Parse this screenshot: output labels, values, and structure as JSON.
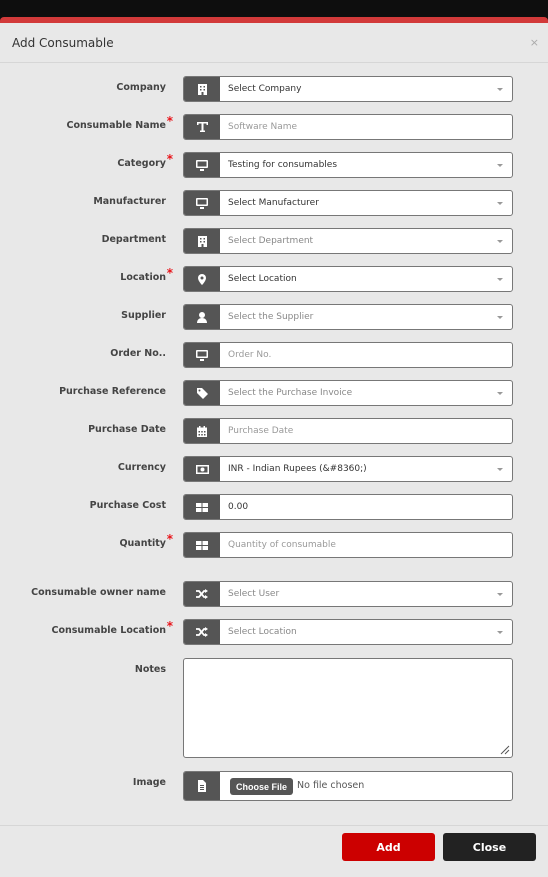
{
  "modal": {
    "title": "Add Consumable",
    "close_symbol": "×"
  },
  "fields": [
    {
      "label": "Company",
      "required": false,
      "icon": "building-icon",
      "type": "select",
      "value": "Select Company",
      "is_placeholder": false
    },
    {
      "label": "Consumable Name",
      "required": true,
      "icon": "text-icon",
      "type": "text",
      "value": "",
      "placeholder": "Software Name"
    },
    {
      "label": "Category",
      "required": true,
      "icon": "monitor-icon",
      "type": "select",
      "value": "Testing for consumables",
      "is_placeholder": false
    },
    {
      "label": "Manufacturer",
      "required": false,
      "icon": "monitor-icon",
      "type": "select",
      "value": "Select Manufacturer",
      "is_placeholder": false
    },
    {
      "label": "Department",
      "required": false,
      "icon": "building-icon",
      "type": "select",
      "value": "Select Department",
      "is_placeholder": true
    },
    {
      "label": "Location",
      "required": true,
      "icon": "map-marker-icon",
      "type": "select",
      "value": "Select Location",
      "is_placeholder": false
    },
    {
      "label": "Supplier",
      "required": false,
      "icon": "user-icon",
      "type": "select",
      "value": "Select the Supplier",
      "is_placeholder": true
    },
    {
      "label": "Order No..",
      "required": false,
      "icon": "monitor-icon",
      "type": "text",
      "value": "",
      "placeholder": "Order No."
    },
    {
      "label": "Purchase Reference",
      "required": false,
      "icon": "tag-icon",
      "type": "select",
      "value": "Select the Purchase Invoice",
      "is_placeholder": true
    },
    {
      "label": "Purchase Date",
      "required": false,
      "icon": "calendar-icon",
      "type": "text",
      "value": "",
      "placeholder": "Purchase Date"
    },
    {
      "label": "Currency",
      "required": false,
      "icon": "money-icon",
      "type": "select",
      "value": "INR - Indian Rupees (&#8360;)",
      "is_placeholder": false
    },
    {
      "label": "Purchase Cost",
      "required": false,
      "icon": "grid-icon",
      "type": "text",
      "value": "0.00",
      "placeholder": ""
    },
    {
      "label": "Quantity",
      "required": true,
      "icon": "grid-icon",
      "type": "text",
      "value": "",
      "placeholder": "Quantity of consumable"
    },
    {
      "label": "Consumable owner name",
      "required": false,
      "icon": "shuffle-icon",
      "type": "select",
      "value": "Select User",
      "is_placeholder": true
    },
    {
      "label": "Consumable Location",
      "required": true,
      "icon": "shuffle-icon",
      "type": "select",
      "value": "Select Location",
      "is_placeholder": true
    }
  ],
  "notes": {
    "label": "Notes",
    "value": ""
  },
  "image": {
    "label": "Image",
    "choose_label": "Choose File",
    "status": "No file chosen"
  },
  "footer": {
    "add_label": "Add",
    "close_label": "Close"
  },
  "colors": {
    "accent_red": "#cc0000",
    "top_bar": "#d23a3a",
    "close_button": "#222222",
    "addon": "#555555",
    "required_star": "#e8141a"
  }
}
